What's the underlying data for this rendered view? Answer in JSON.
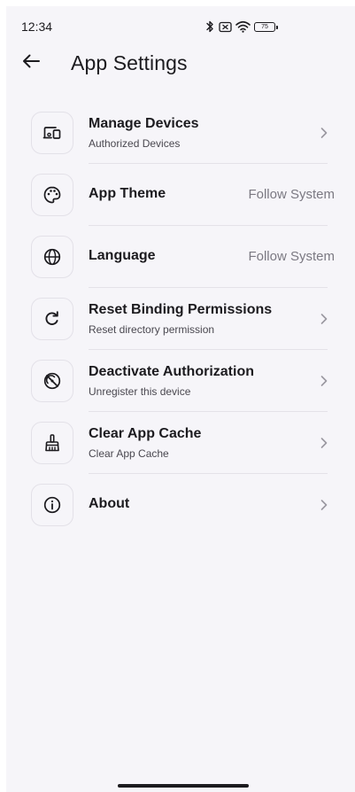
{
  "status_bar": {
    "time": "12:34",
    "battery": "75",
    "icons": [
      "bluetooth-icon",
      "no-sim-icon",
      "wifi-icon",
      "battery-icon"
    ]
  },
  "header": {
    "back_icon": "arrow-left-icon",
    "title": "App Settings"
  },
  "settings": [
    {
      "id": "manage-devices",
      "icon": "devices-icon",
      "title": "Manage Devices",
      "subtitle": "Authorized Devices",
      "value": "",
      "chevron": true
    },
    {
      "id": "app-theme",
      "icon": "palette-icon",
      "title": "App Theme",
      "subtitle": "",
      "value": "Follow System",
      "chevron": false
    },
    {
      "id": "language",
      "icon": "globe-icon",
      "title": "Language",
      "subtitle": "",
      "value": "Follow System",
      "chevron": false
    },
    {
      "id": "reset-binding-permissions",
      "icon": "refresh-icon",
      "title": "Reset Binding Permissions",
      "subtitle": "Reset directory permission",
      "value": "",
      "chevron": true
    },
    {
      "id": "deactivate-authorization",
      "icon": "gauge-off-icon",
      "title": "Deactivate Authorization",
      "subtitle": "Unregister this device",
      "value": "",
      "chevron": true
    },
    {
      "id": "clear-app-cache",
      "icon": "broom-icon",
      "title": "Clear App Cache",
      "subtitle": "Clear App Cache",
      "value": "",
      "chevron": true
    },
    {
      "id": "about",
      "icon": "info-icon",
      "title": "About",
      "subtitle": "",
      "value": "",
      "chevron": true
    }
  ],
  "colors": {
    "background": "#f6f5f9",
    "text_primary": "#1c1b1f",
    "text_secondary": "#4a4850",
    "text_value": "#7b7982",
    "chevron": "#9a98a0",
    "divider": "#e4e2e8"
  }
}
